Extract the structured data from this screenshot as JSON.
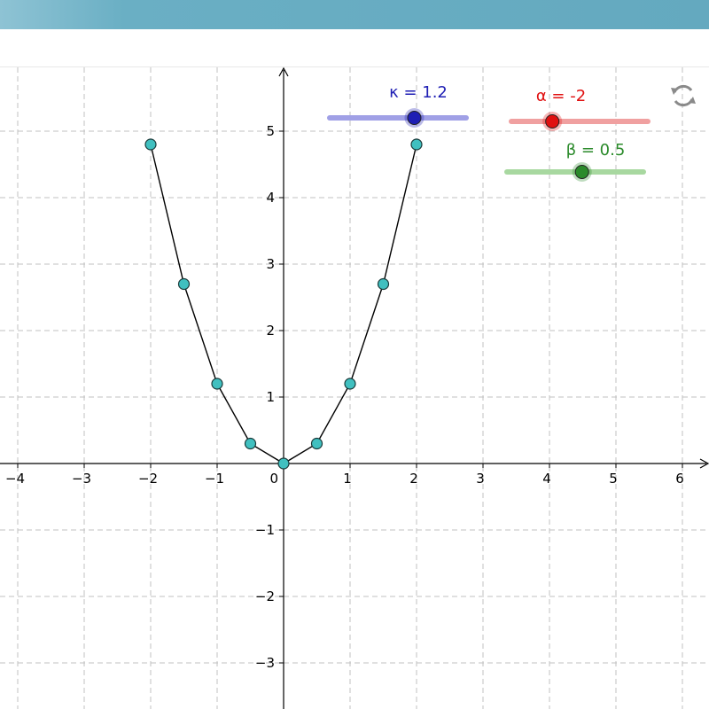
{
  "sliders": [
    {
      "name": "kappa",
      "label": "κ = 1.2",
      "value": 1.2,
      "min": -5,
      "max": 5,
      "color": "#1f1fb4",
      "track_color": "#a0a0e6"
    },
    {
      "name": "alpha",
      "label": "α = -2",
      "value": -2,
      "min": -5,
      "max": 5,
      "color": "#e01010",
      "track_color": "#f0a0a0"
    },
    {
      "name": "beta",
      "label": "β = 0.5",
      "value": 0.5,
      "min": -5,
      "max": 5,
      "color": "#2a8a2a",
      "track_color": "#a8d8a0"
    }
  ],
  "reset_icon": "refresh-icon",
  "chart_data": {
    "type": "scatter",
    "xlim": [
      -4.3,
      6.4
    ],
    "ylim": [
      -3.4,
      6.0
    ],
    "grid": true,
    "x_ticks": [
      -4,
      -3,
      -2,
      -1,
      1,
      2,
      3,
      4,
      5,
      6
    ],
    "y_ticks": [
      -3,
      -2,
      -1,
      1,
      2,
      3,
      4,
      5
    ],
    "x_tick_labels": [
      "−4",
      "−3",
      "−2",
      "−1",
      "1",
      "2",
      "3",
      "4",
      "5",
      "6"
    ],
    "y_tick_labels": [
      "−3",
      "−2",
      "−1",
      "1",
      "2",
      "3",
      "4",
      "5"
    ],
    "origin_label": "0",
    "series": [
      {
        "points": [
          {
            "x": -2,
            "y": 4.8
          },
          {
            "x": -1.5,
            "y": 2.7
          },
          {
            "x": -1,
            "y": 1.2
          },
          {
            "x": -0.5,
            "y": 0.3
          },
          {
            "x": 0,
            "y": 0
          },
          {
            "x": 0.5,
            "y": 0.3
          },
          {
            "x": 1,
            "y": 1.2
          },
          {
            "x": 1.5,
            "y": 2.7
          },
          {
            "x": 2,
            "y": 4.8
          }
        ],
        "line_color": "#000000",
        "point_color": "#40c0c0"
      }
    ]
  }
}
